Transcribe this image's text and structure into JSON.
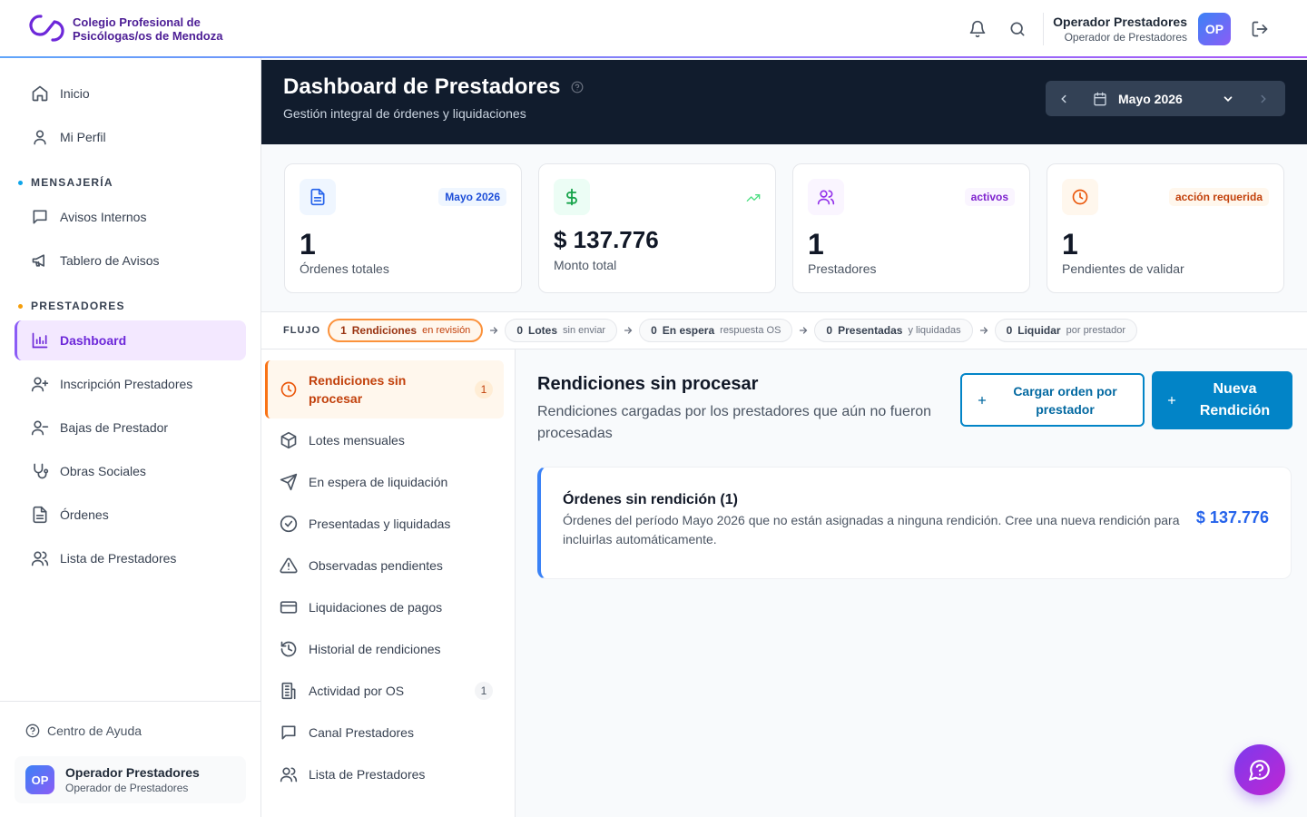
{
  "header": {
    "org_line1": "Colegio Profesional de",
    "org_line2": "Psicólogas/os de Mendoza",
    "user_name": "Operador Prestadores",
    "user_role": "Operador de Prestadores",
    "avatar": "OP"
  },
  "sidebar": {
    "items_top": [
      {
        "label": "Inicio",
        "icon": "home-icon"
      },
      {
        "label": "Mi Perfil",
        "icon": "user-icon"
      }
    ],
    "section_messaging": "MENSAJERÍA",
    "items_messaging": [
      {
        "label": "Avisos Internos",
        "icon": "message-square-icon"
      },
      {
        "label": "Tablero de Avisos",
        "icon": "megaphone-icon"
      }
    ],
    "section_providers": "PRESTADORES",
    "items_providers": [
      {
        "label": "Dashboard",
        "icon": "bar-chart-icon",
        "active": true
      },
      {
        "label": "Inscripción Prestadores",
        "icon": "user-plus-icon"
      },
      {
        "label": "Bajas de Prestador",
        "icon": "user-minus-icon"
      },
      {
        "label": "Obras Sociales",
        "icon": "stethoscope-icon"
      },
      {
        "label": "Órdenes",
        "icon": "file-text-icon"
      },
      {
        "label": "Lista de Prestadores",
        "icon": "users-icon"
      }
    ],
    "help": "Centro de Ayuda",
    "user_name": "Operador Prestadores",
    "user_role": "Operador de Prestadores",
    "avatar": "OP",
    "colors": {
      "messaging_dot": "#0ea5e9",
      "providers_dot": "#f59e0b",
      "active": "#6d28d9"
    }
  },
  "banner": {
    "title": "Dashboard de Prestadores",
    "subtitle": "Gestión integral de órdenes y liquidaciones",
    "period": "Mayo 2026"
  },
  "stats": [
    {
      "value": "1",
      "label": "Órdenes totales",
      "badge": "Mayo 2026",
      "icon": "file-text-icon"
    },
    {
      "value": "$ 137.776",
      "label": "Monto total",
      "badge": "",
      "icon": "dollar-icon"
    },
    {
      "value": "1",
      "label": "Prestadores",
      "badge": "activos",
      "icon": "users-icon"
    },
    {
      "value": "1",
      "label": "Pendientes de validar",
      "badge": "acción requerida",
      "icon": "clock-icon"
    }
  ],
  "flow": {
    "label": "FLUJO",
    "steps": [
      {
        "count": "1",
        "name": "Rendiciones",
        "hint": "en revisión",
        "active": true
      },
      {
        "count": "0",
        "name": "Lotes",
        "hint": "sin enviar"
      },
      {
        "count": "0",
        "name": "En espera",
        "hint": "respuesta OS"
      },
      {
        "count": "0",
        "name": "Presentadas",
        "hint": "y liquidadas"
      },
      {
        "count": "0",
        "name": "Liquidar",
        "hint": "por prestador"
      }
    ]
  },
  "subnav": [
    {
      "label": "Rendiciones sin procesar",
      "count": "1",
      "icon": "clock-icon",
      "active": true
    },
    {
      "label": "Lotes mensuales",
      "count": "",
      "icon": "package-icon"
    },
    {
      "label": "En espera de liquidación",
      "count": "",
      "icon": "send-icon"
    },
    {
      "label": "Presentadas y liquidadas",
      "count": "",
      "icon": "check-circle-icon"
    },
    {
      "label": "Observadas pendientes",
      "count": "",
      "icon": "alert-triangle-icon"
    },
    {
      "label": "Liquidaciones de pagos",
      "count": "",
      "icon": "credit-card-icon"
    },
    {
      "label": "Historial de rendiciones",
      "count": "",
      "icon": "history-icon"
    },
    {
      "label": "Actividad por OS",
      "count": "1",
      "icon": "building-icon"
    },
    {
      "label": "Canal Prestadores",
      "count": "",
      "icon": "message-square-icon"
    },
    {
      "label": "Lista de Prestadores",
      "count": "",
      "icon": "users-icon"
    }
  ],
  "main": {
    "title": "Rendiciones sin procesar",
    "description": "Rendiciones cargadas por los prestadores que aún no fueron procesadas",
    "btn_load": "Cargar orden por prestador",
    "btn_new": "Nueva Rendición",
    "card_title": "Órdenes sin rendición (1)",
    "card_text": "Órdenes del período Mayo 2026 que no están asignadas a ninguna rendición. Cree una nueva rendición para incluirlas automáticamente.",
    "card_amount": "$ 137.776"
  },
  "colors": {
    "accent_blue": "#0284c7",
    "accent_orange": "#f97316",
    "accent_purple": "#8b5cf6",
    "banner_bg": "#111c2d"
  }
}
